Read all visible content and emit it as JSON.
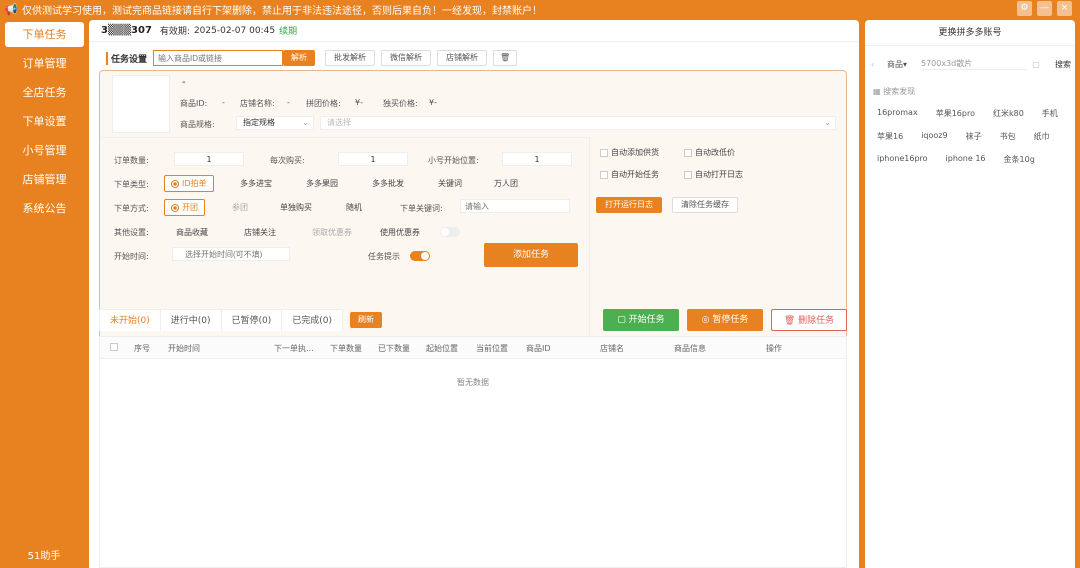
{
  "topbar": {
    "notice": "仅供测试学习使用，测试完商品链接请自行下架删除，禁止用于非法违法途径，否则后果自负！一经发现，封禁账户！",
    "buttons": [
      "⚙",
      "—",
      "×"
    ]
  },
  "sidebar": {
    "items": [
      {
        "label": "下单任务"
      },
      {
        "label": "订单管理"
      },
      {
        "label": "全店任务"
      },
      {
        "label": "下单设置"
      },
      {
        "label": "小号管理"
      },
      {
        "label": "店铺管理"
      },
      {
        "label": "系统公告"
      }
    ],
    "footer": "51助手"
  },
  "account": {
    "id": "3▒▒▒307",
    "expiry_label": "有效期:",
    "expiry": "2025-02-07 00:45",
    "renew": "续期"
  },
  "settings": {
    "title": "任务设置",
    "url_placeholder": "输入商品ID或链接",
    "parse_btn": "解析",
    "batch_btn": "批发解析",
    "wechat_btn": "微信解析",
    "shop_btn": "店铺解析",
    "product_name": "-",
    "product_id_label": "商品ID:",
    "product_id": "-",
    "shop_label": "店铺名称:",
    "shop": "-",
    "group_price_label": "拼团价格:",
    "group_price": "¥-",
    "single_price_label": "独买价格:",
    "single_price": "¥-",
    "spec_label": "商品规格:",
    "spec_value": "指定规格",
    "spec_placeholder": "请选择",
    "order_qty_label": "订单数量:",
    "order_qty": "1",
    "per_buy_label": "每次购买:",
    "per_buy": "1",
    "start_pos_label": "小号开始位置:",
    "start_pos": "1",
    "auto_supply": "自动添加供货",
    "auto_price": "自动改低价",
    "auto_start": "自动开始任务",
    "auto_log": "自动打开日志",
    "open_log_btn": "打开运行日志",
    "clear_cache_btn": "清除任务缓存",
    "order_type_label": "下单类型:",
    "order_types": [
      "ID拍单",
      "多多进宝",
      "多多果园",
      "多多批发",
      "关键词",
      "万人团"
    ],
    "order_method_label": "下单方式:",
    "order_methods": [
      "开团",
      "参团",
      "单独购买",
      "随机"
    ],
    "keyword_label": "下单关键词:",
    "keyword_placeholder": "请输入",
    "other_label": "其他设置:",
    "other_options": [
      "商品收藏",
      "店铺关注",
      "领取优惠券",
      "使用优惠券"
    ],
    "start_time_label": "开始时间:",
    "start_time_placeholder": "选择开始时间(可不填)",
    "task_tip_label": "任务提示",
    "add_task_btn": "添加任务"
  },
  "tabs": [
    {
      "label": "未开始(0)"
    },
    {
      "label": "进行中(0)"
    },
    {
      "label": "已暂停(0)"
    },
    {
      "label": "已完成(0)"
    }
  ],
  "refresh_btn": "刷新",
  "actions": {
    "start": "开始任务",
    "pause": "暂停任务",
    "delete": "删除任务"
  },
  "table": {
    "headers": [
      "序号",
      "开始时间",
      "下一单执...",
      "下单数量",
      "已下数量",
      "起始位置",
      "当前位置",
      "商品ID",
      "店铺名",
      "商品信息",
      "操作"
    ],
    "empty": "暂无数据"
  },
  "right_panel": {
    "title": "更换拼多多账号",
    "category": "商品▾",
    "search_value": "5700x3d散片",
    "search_btn": "搜索",
    "hint": "搜索发现",
    "chips": [
      "16promax",
      "苹果16pro",
      "红米k80",
      "手机",
      "苹果16",
      "iqooz9",
      "袜子",
      "书包",
      "纸巾",
      "iphone16pro",
      "iphone 16",
      "金条10g"
    ]
  },
  "colors": {
    "accent": "#e8811f",
    "green": "#4caf50",
    "danger": "#e0625a"
  }
}
